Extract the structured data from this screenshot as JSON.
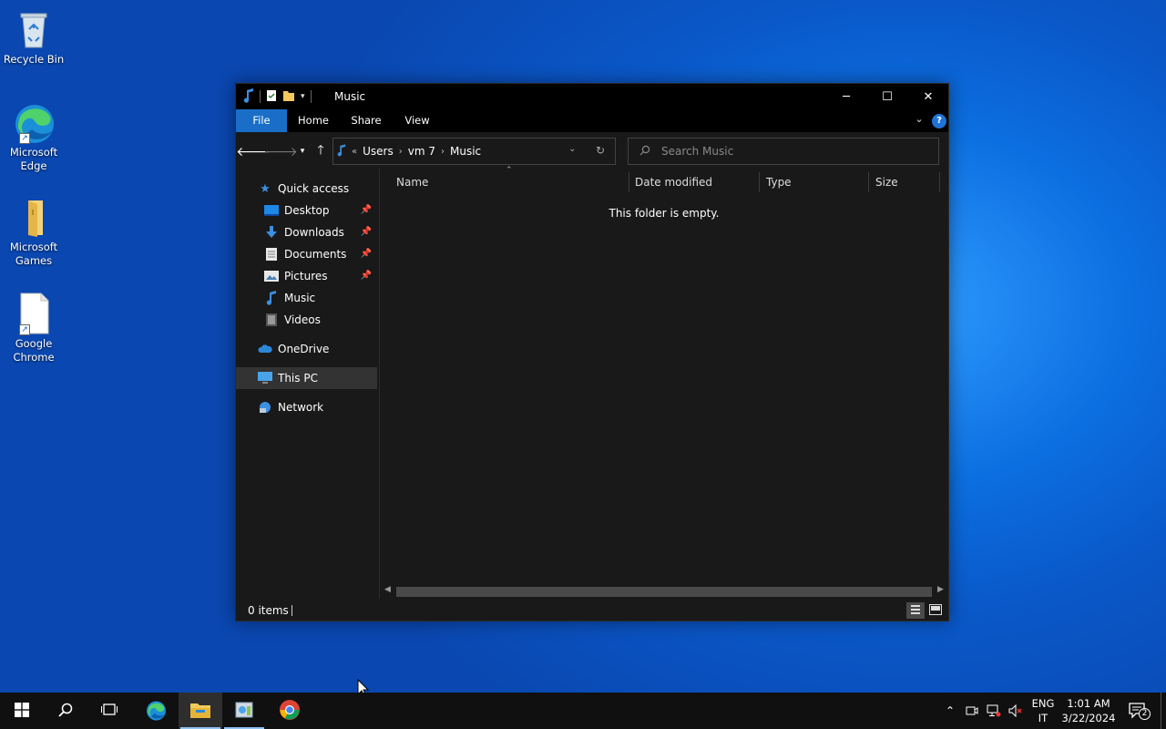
{
  "desktop": {
    "icons": [
      {
        "label": "Recycle Bin"
      },
      {
        "label": "Microsoft Edge"
      },
      {
        "label": "Microsoft Games"
      },
      {
        "label": "Google Chrome"
      }
    ]
  },
  "window": {
    "title": "Music",
    "controls": {
      "minimize": "─",
      "maximize": "☐",
      "close": "✕"
    },
    "ribbon": {
      "tabs": [
        "File",
        "Home",
        "Share",
        "View"
      ]
    },
    "address": {
      "overflow": "«",
      "crumbs": [
        "Users",
        "vm 7",
        "Music"
      ]
    },
    "search": {
      "placeholder": "Search Music"
    },
    "nav_pane": {
      "quick_access": "Quick access",
      "items": [
        "Desktop",
        "Downloads",
        "Documents",
        "Pictures",
        "Music",
        "Videos"
      ],
      "onedrive": "OneDrive",
      "this_pc": "This PC",
      "network": "Network"
    },
    "columns": [
      "Name",
      "Date modified",
      "Type",
      "Size"
    ],
    "empty_message": "This folder is empty.",
    "status": {
      "item_count": "0 items"
    }
  },
  "taskbar": {
    "language": {
      "line1": "ENG",
      "line2": "IT"
    },
    "clock": {
      "time": "1:01 AM",
      "date": "3/22/2024"
    },
    "notifications_count": "2"
  },
  "colors": {
    "accent": "#1a6ec7",
    "window_bg": "#191919",
    "titlebar_bg": "#000000",
    "taskbar_bg": "#101010"
  }
}
